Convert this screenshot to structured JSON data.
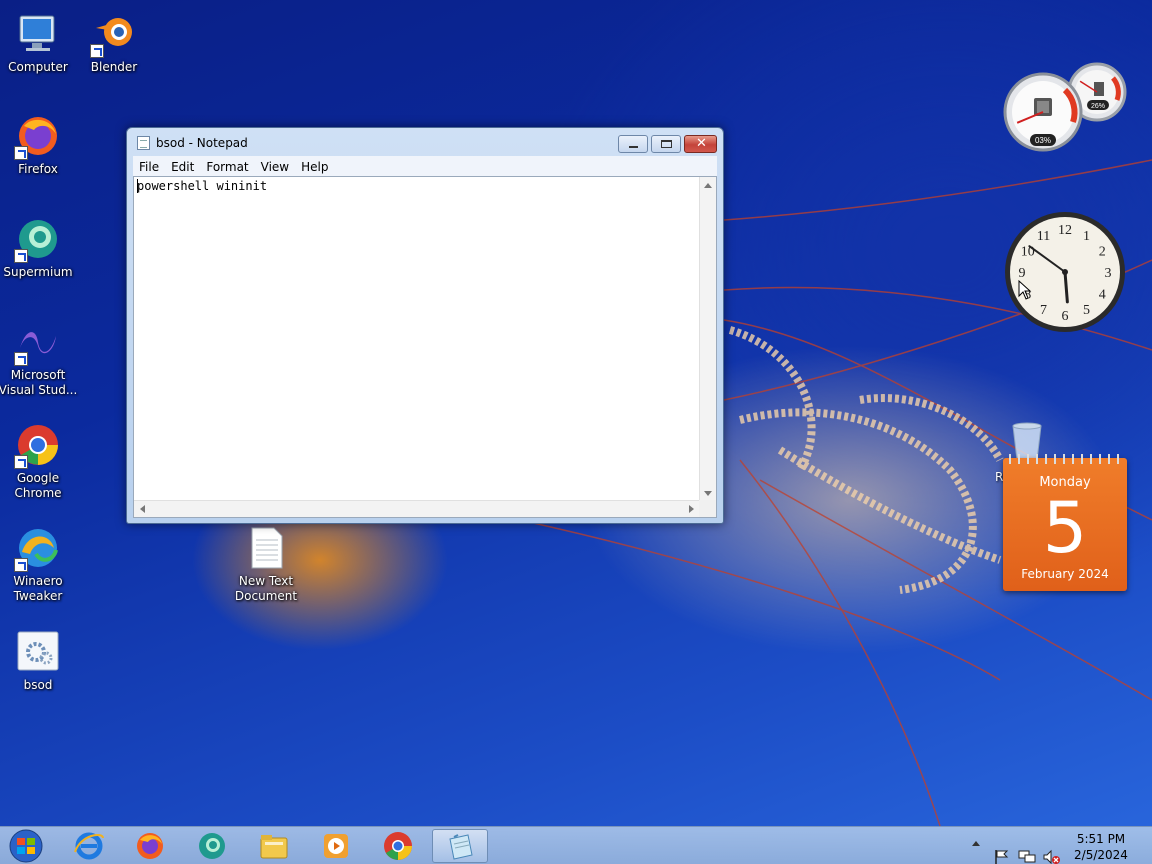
{
  "desktop": {
    "icons": [
      {
        "label": "Computer"
      },
      {
        "label": "Blender"
      },
      {
        "label": "Firefox"
      },
      {
        "label": "Supermium"
      },
      {
        "label": "Microsoft Visual Stud..."
      },
      {
        "label": "Google Chrome"
      },
      {
        "label": "Winaero Tweaker"
      },
      {
        "label": "bsod"
      },
      {
        "label": "New Text Document"
      }
    ],
    "recycle_bin_label": "R"
  },
  "notepad": {
    "title": "bsod - Notepad",
    "menu": [
      "File",
      "Edit",
      "Format",
      "View",
      "Help"
    ],
    "content": "powershell wininit"
  },
  "gadgets": {
    "meter": {
      "cpu_label": "03%",
      "memory_label": "26%",
      "cpu_value": 3,
      "memory_value": 26
    },
    "clock": {
      "hour": 5,
      "minute": 51,
      "numbers": [
        "12",
        "1",
        "2",
        "3",
        "4",
        "5",
        "6",
        "7",
        "8",
        "9",
        "10",
        "11"
      ]
    },
    "calendar": {
      "weekday": "Monday",
      "day": "5",
      "month_year": "February 2024"
    }
  },
  "taskbar": {
    "time": "5:51 PM",
    "date": "2/5/2024",
    "apps": [
      "internet-explorer",
      "firefox",
      "supermium",
      "file-explorer",
      "media-player",
      "chrome",
      "notepad"
    ]
  },
  "colors": {
    "accent": "#1a4fd0",
    "calendar": "#e66a1e",
    "close_button": "#c4433a"
  }
}
